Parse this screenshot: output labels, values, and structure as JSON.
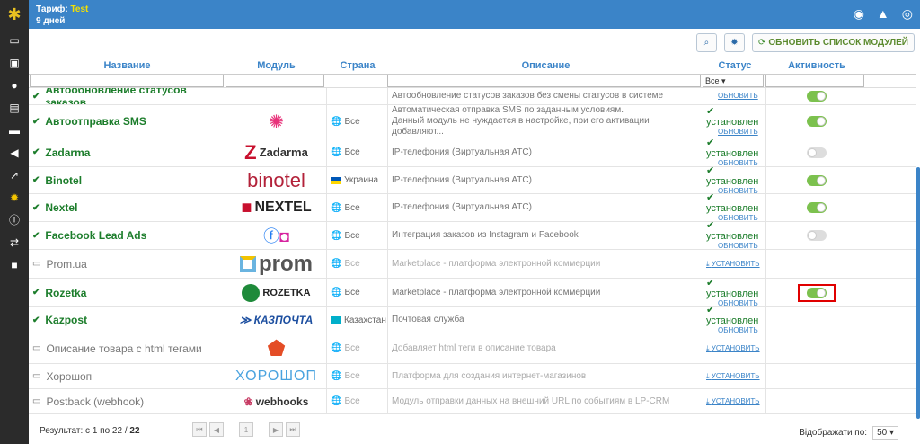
{
  "header": {
    "plan_label": "Тариф:",
    "plan_value": "Test",
    "days": "9 дней"
  },
  "toolbar": {
    "refresh_label": "ОБНОВИТЬ СПИСОК МОДУЛЕЙ"
  },
  "columns": [
    "Название",
    "Модуль",
    "Страна",
    "Описание",
    "Статус",
    "Активность"
  ],
  "filter": {
    "status_value": "Все"
  },
  "partial_row": {
    "name": "Автообновление статусов заказов",
    "desc": "Автообновление статусов заказов без смены статусов в системе",
    "status_link": "ОБНОВИТЬ"
  },
  "rows": [
    {
      "name": "Автоотправка SMS",
      "active": true,
      "country": "Все",
      "flag": "globe",
      "desc1": "Автоматическая отправка SMS по заданным условиям.",
      "desc2": "Данный модуль не нуждается в настройке, при его активации добавляют...",
      "status": "установлен",
      "status_link": "ОБНОВИТЬ",
      "toggle": "on"
    },
    {
      "name": "Zadarma",
      "active": true,
      "country": "Все",
      "flag": "globe",
      "desc1": "IP-телефония (Виртуальная АТС)",
      "desc2": "",
      "status": "установлен",
      "status_link": "ОБНОВИТЬ",
      "toggle": "off",
      "logo": "Zadarma"
    },
    {
      "name": "Binotel",
      "active": true,
      "country": "Украина",
      "flag": "ua",
      "desc1": "IP-телефония (Виртуальная АТС)",
      "desc2": "",
      "status": "установлен",
      "status_link": "ОБНОВИТЬ",
      "toggle": "on",
      "logo": "binotel"
    },
    {
      "name": "Nextel",
      "active": true,
      "country": "Все",
      "flag": "globe",
      "desc1": "IP-телефония (Виртуальная АТС)",
      "desc2": "",
      "status": "установлен",
      "status_link": "ОБНОВИТЬ",
      "toggle": "on",
      "logo": "NEXTEL"
    },
    {
      "name": "Facebook Lead Ads",
      "active": true,
      "country": "Все",
      "flag": "globe",
      "desc1": "Интеграция заказов из Instagram и Facebook",
      "desc2": "",
      "status": "установлен",
      "status_link": "ОБНОВИТЬ",
      "toggle": "off"
    },
    {
      "name": "Prom.ua",
      "active": false,
      "country": "Все",
      "flag": "globe",
      "desc1": "Marketplace - платформа электронной коммерции",
      "desc2": "",
      "status": "",
      "status_link": "УСТАНОВИТЬ",
      "toggle": "none",
      "logo": "prom"
    },
    {
      "name": "Rozetka",
      "active": true,
      "country": "Все",
      "flag": "globe",
      "desc1": "Marketplace - платформа электронной коммерции",
      "desc2": "",
      "status": "установлен",
      "status_link": "ОБНОВИТЬ",
      "toggle": "on",
      "logo": "ROZETKA"
    },
    {
      "name": "Kazpost",
      "active": true,
      "country": "Казахстан",
      "flag": "kz",
      "desc1": "Почтовая служба",
      "desc2": "",
      "status": "установлен",
      "status_link": "ОБНОВИТЬ",
      "toggle": "none",
      "logo": "КАЗПОЧТА"
    },
    {
      "name": "Описание товара с html тегами",
      "active": false,
      "country": "Все",
      "flag": "globe",
      "desc1": "Добавляет html теги в описание товара",
      "desc2": "",
      "status": "",
      "status_link": "УСТАНОВИТЬ",
      "toggle": "none",
      "logo": "HTML"
    },
    {
      "name": "Хорошоп",
      "active": false,
      "country": "Все",
      "flag": "globe",
      "desc1": "Платформа для создания интернет-магазинов",
      "desc2": "",
      "status": "",
      "status_link": "УСТАНОВИТЬ",
      "toggle": "none",
      "logo": "ХОРОШОП"
    },
    {
      "name": "Postback (webhook)",
      "active": false,
      "country": "Все",
      "flag": "globe",
      "desc1": "Модуль отправки данных на внешний URL по событиям в LP-CRM",
      "desc2": "",
      "status": "",
      "status_link": "УСТАНОВИТЬ",
      "toggle": "none",
      "logo": "webhooks"
    }
  ],
  "footer": {
    "result_label": "Результат:",
    "range": "с 1 по 22 /",
    "total": "22",
    "page": "1",
    "per_page_label": "Відображати по:",
    "per_page_value": "50"
  }
}
